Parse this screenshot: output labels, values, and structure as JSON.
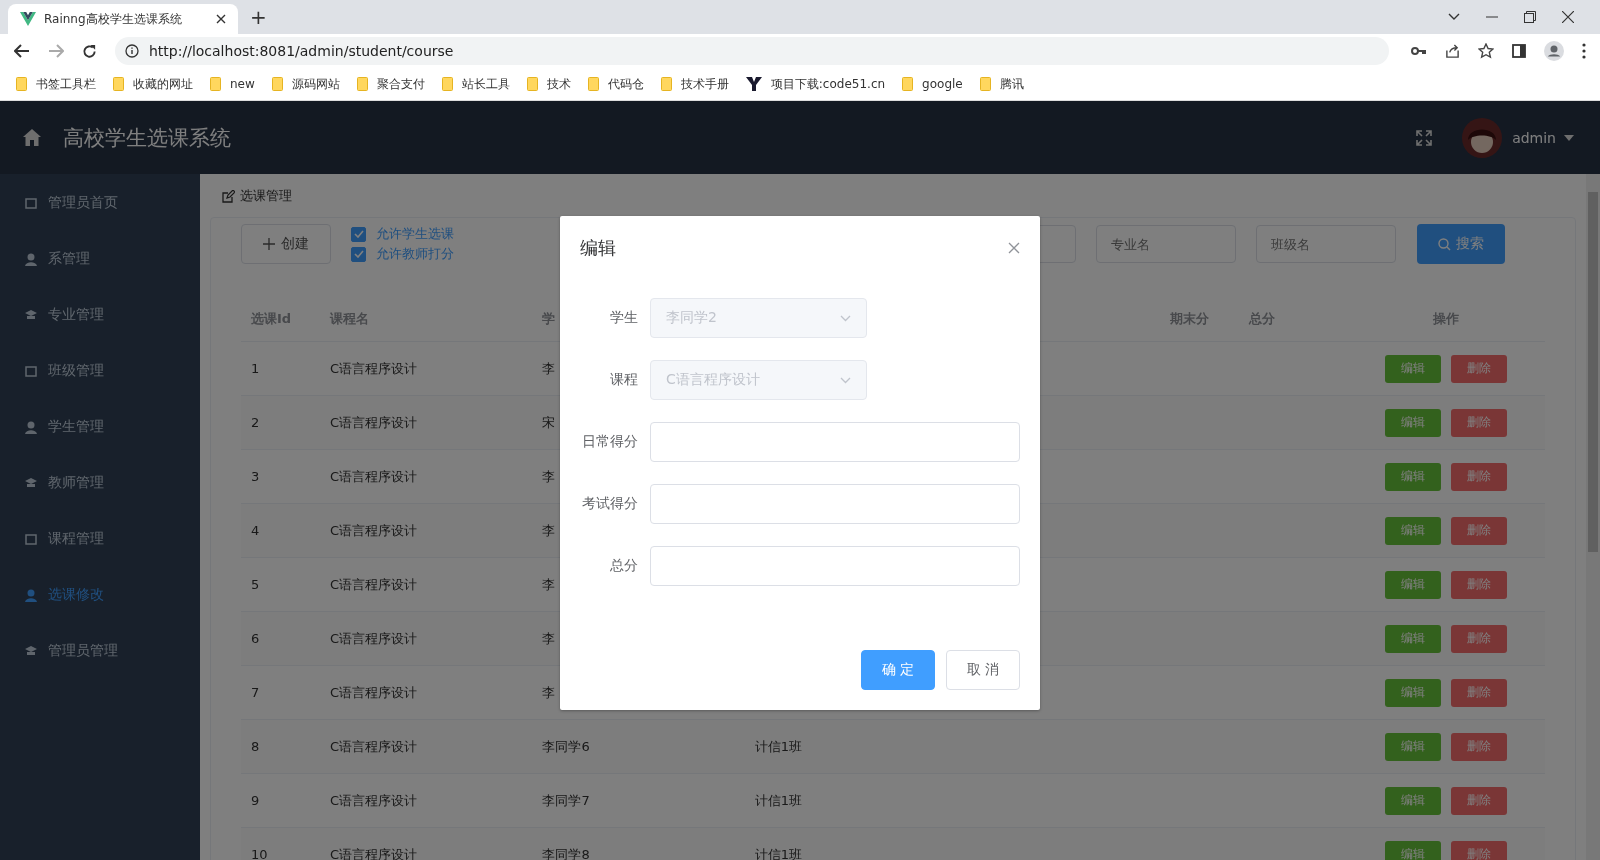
{
  "browser": {
    "tab_title": "Rainng高校学生选课系统",
    "new_tab": "+",
    "url": "http://localhost:8081/admin/student/course",
    "bookmarks": [
      {
        "label": "书签工具栏",
        "kind": "folder"
      },
      {
        "label": "收藏的网址",
        "kind": "folder"
      },
      {
        "label": "new",
        "kind": "folder"
      },
      {
        "label": "源码网站",
        "kind": "folder"
      },
      {
        "label": "聚合支付",
        "kind": "folder"
      },
      {
        "label": "站长工具",
        "kind": "folder"
      },
      {
        "label": "技术",
        "kind": "folder"
      },
      {
        "label": "代码仓",
        "kind": "folder"
      },
      {
        "label": "技术手册",
        "kind": "folder"
      },
      {
        "label": "项目下载:code51.cn",
        "kind": "site"
      },
      {
        "label": "google",
        "kind": "folder"
      },
      {
        "label": "腾讯",
        "kind": "folder"
      }
    ]
  },
  "app": {
    "title": "高校学生选课系统",
    "user": "admin"
  },
  "sidebar": {
    "items": [
      {
        "label": "管理员首页",
        "selected": false
      },
      {
        "label": "系管理",
        "selected": false
      },
      {
        "label": "专业管理",
        "selected": false
      },
      {
        "label": "班级管理",
        "selected": false
      },
      {
        "label": "学生管理",
        "selected": false
      },
      {
        "label": "教师管理",
        "selected": false
      },
      {
        "label": "课程管理",
        "selected": false
      },
      {
        "label": "选课修改",
        "selected": true
      },
      {
        "label": "管理员管理",
        "selected": false
      }
    ]
  },
  "breadcrumb": "选课管理",
  "toolbar": {
    "create_button": "创建",
    "checkboxes": [
      {
        "label": "允许学生选课",
        "checked": true
      },
      {
        "label": "允许教师打分",
        "checked": true
      }
    ],
    "filters": [
      {
        "placeholder": "专业名"
      },
      {
        "placeholder": "班级名"
      }
    ],
    "search_button": "搜索"
  },
  "table": {
    "columns": [
      {
        "label": "选课Id"
      },
      {
        "label": "课程名"
      },
      {
        "label": "学"
      },
      {},
      {
        "label": "期末分"
      },
      {
        "label": "总分"
      },
      {
        "label": "操作"
      }
    ],
    "rows": [
      {
        "id": "1",
        "course": "C语言程序设计",
        "student": "李",
        "actions": [
          "编辑",
          "删除"
        ]
      },
      {
        "id": "2",
        "course": "C语言程序设计",
        "student": "宋",
        "actions": [
          "编辑",
          "删除"
        ]
      },
      {
        "id": "3",
        "course": "C语言程序设计",
        "student": "李",
        "actions": [
          "编辑",
          "删除"
        ]
      },
      {
        "id": "4",
        "course": "C语言程序设计",
        "student": "李",
        "actions": [
          "编辑",
          "删除"
        ]
      },
      {
        "id": "5",
        "course": "C语言程序设计",
        "student": "李",
        "actions": [
          "编辑",
          "删除"
        ]
      },
      {
        "id": "6",
        "course": "C语言程序设计",
        "student": "李",
        "actions": [
          "编辑",
          "删除"
        ]
      },
      {
        "id": "7",
        "course": "C语言程序设计",
        "student": "李",
        "actions": [
          "编辑",
          "删除"
        ]
      },
      {
        "id": "8",
        "course": "C语言程序设计",
        "student": "李同学6",
        "class": "计信1班",
        "actions": [
          "编辑",
          "删除"
        ]
      },
      {
        "id": "9",
        "course": "C语言程序设计",
        "student": "李同学7",
        "class": "计信1班",
        "actions": [
          "编辑",
          "删除"
        ]
      },
      {
        "id": "10",
        "course": "C语言程序设计",
        "student": "李同学8",
        "class": "计信1班",
        "actions": [
          "编辑",
          "删除"
        ]
      }
    ]
  },
  "dialog": {
    "title": "编辑",
    "fields": [
      {
        "label": "学生",
        "kind": "select",
        "value": "李同学2",
        "disabled": true
      },
      {
        "label": "课程",
        "kind": "select",
        "value": "C语言程序设计",
        "disabled": true
      },
      {
        "label": "日常得分",
        "kind": "input"
      },
      {
        "label": "考试得分",
        "kind": "input"
      },
      {
        "label": "总分",
        "kind": "input"
      }
    ],
    "buttons": [
      {
        "label": "确 定",
        "primary": true
      },
      {
        "label": "取 消",
        "primary": false
      }
    ]
  }
}
